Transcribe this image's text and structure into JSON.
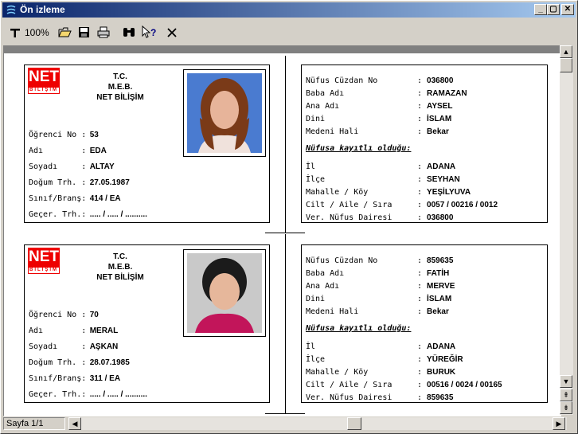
{
  "window": {
    "title": "Ön izleme"
  },
  "toolbar": {
    "zoom_label": "100%"
  },
  "statusbar": {
    "page": "Sayfa 1/1"
  },
  "cards": [
    {
      "logo": {
        "top": "NET",
        "bottom": "BİLİŞİM"
      },
      "header": [
        "T.C.",
        "M.E.B.",
        "NET BİLİŞİM"
      ],
      "left_fields": [
        {
          "label": "Öğrenci No :",
          "value": "53"
        },
        {
          "label": "Adı        :",
          "value": "EDA"
        },
        {
          "label": "Soyadı     :",
          "value": "ALTAY"
        },
        {
          "label": "Doğum Trh. :",
          "value": "27.05.1987"
        },
        {
          "label": "Sınıf/Branş:",
          "value": "414 / EA"
        },
        {
          "label": "Geçer. Trh.:",
          "value": "..... / ..... / .........."
        }
      ],
      "right_fields_a": [
        {
          "label": "Nüfus Cüzdan No",
          "value": "036800"
        },
        {
          "label": "Baba Adı",
          "value": "RAMAZAN"
        },
        {
          "label": "Ana Adı",
          "value": "AYSEL"
        },
        {
          "label": "Dini",
          "value": "İSLAM"
        },
        {
          "label": "Medeni Hali",
          "value": "Bekar"
        }
      ],
      "registered_label": "Nüfusa kayıtlı olduğu:",
      "right_fields_b": [
        {
          "label": "İl",
          "value": "ADANA"
        },
        {
          "label": "İlçe",
          "value": "SEYHAN"
        },
        {
          "label": "Mahalle / Köy",
          "value": "YEŞİLYUVA"
        },
        {
          "label": "Cilt / Aile / Sıra",
          "value": "0057 / 00216 / 0012"
        },
        {
          "label": "Ver. Nüfus Dairesi",
          "value": "036800"
        }
      ]
    },
    {
      "logo": {
        "top": "NET",
        "bottom": "BİLİŞİM"
      },
      "header": [
        "T.C.",
        "M.E.B.",
        "NET BİLİŞİM"
      ],
      "left_fields": [
        {
          "label": "Öğrenci No :",
          "value": "70"
        },
        {
          "label": "Adı        :",
          "value": "MERAL"
        },
        {
          "label": "Soyadı     :",
          "value": "AŞKAN"
        },
        {
          "label": "Doğum Trh. :",
          "value": "28.07.1985"
        },
        {
          "label": "Sınıf/Branş:",
          "value": "311 / EA"
        },
        {
          "label": "Geçer. Trh.:",
          "value": "..... / ..... / .........."
        }
      ],
      "right_fields_a": [
        {
          "label": "Nüfus Cüzdan No",
          "value": "859635"
        },
        {
          "label": "Baba Adı",
          "value": "FATİH"
        },
        {
          "label": "Ana Adı",
          "value": "MERVE"
        },
        {
          "label": "Dini",
          "value": "İSLAM"
        },
        {
          "label": "Medeni Hali",
          "value": "Bekar"
        }
      ],
      "registered_label": "Nüfusa kayıtlı olduğu:",
      "right_fields_b": [
        {
          "label": "İl",
          "value": "ADANA"
        },
        {
          "label": "İlçe",
          "value": "YÜREĞİR"
        },
        {
          "label": "Mahalle / Köy",
          "value": "BURUK"
        },
        {
          "label": "Cilt / Aile / Sıra",
          "value": "00516 / 0024 / 00165"
        },
        {
          "label": "Ver. Nüfus Dairesi",
          "value": "859635"
        }
      ]
    }
  ]
}
